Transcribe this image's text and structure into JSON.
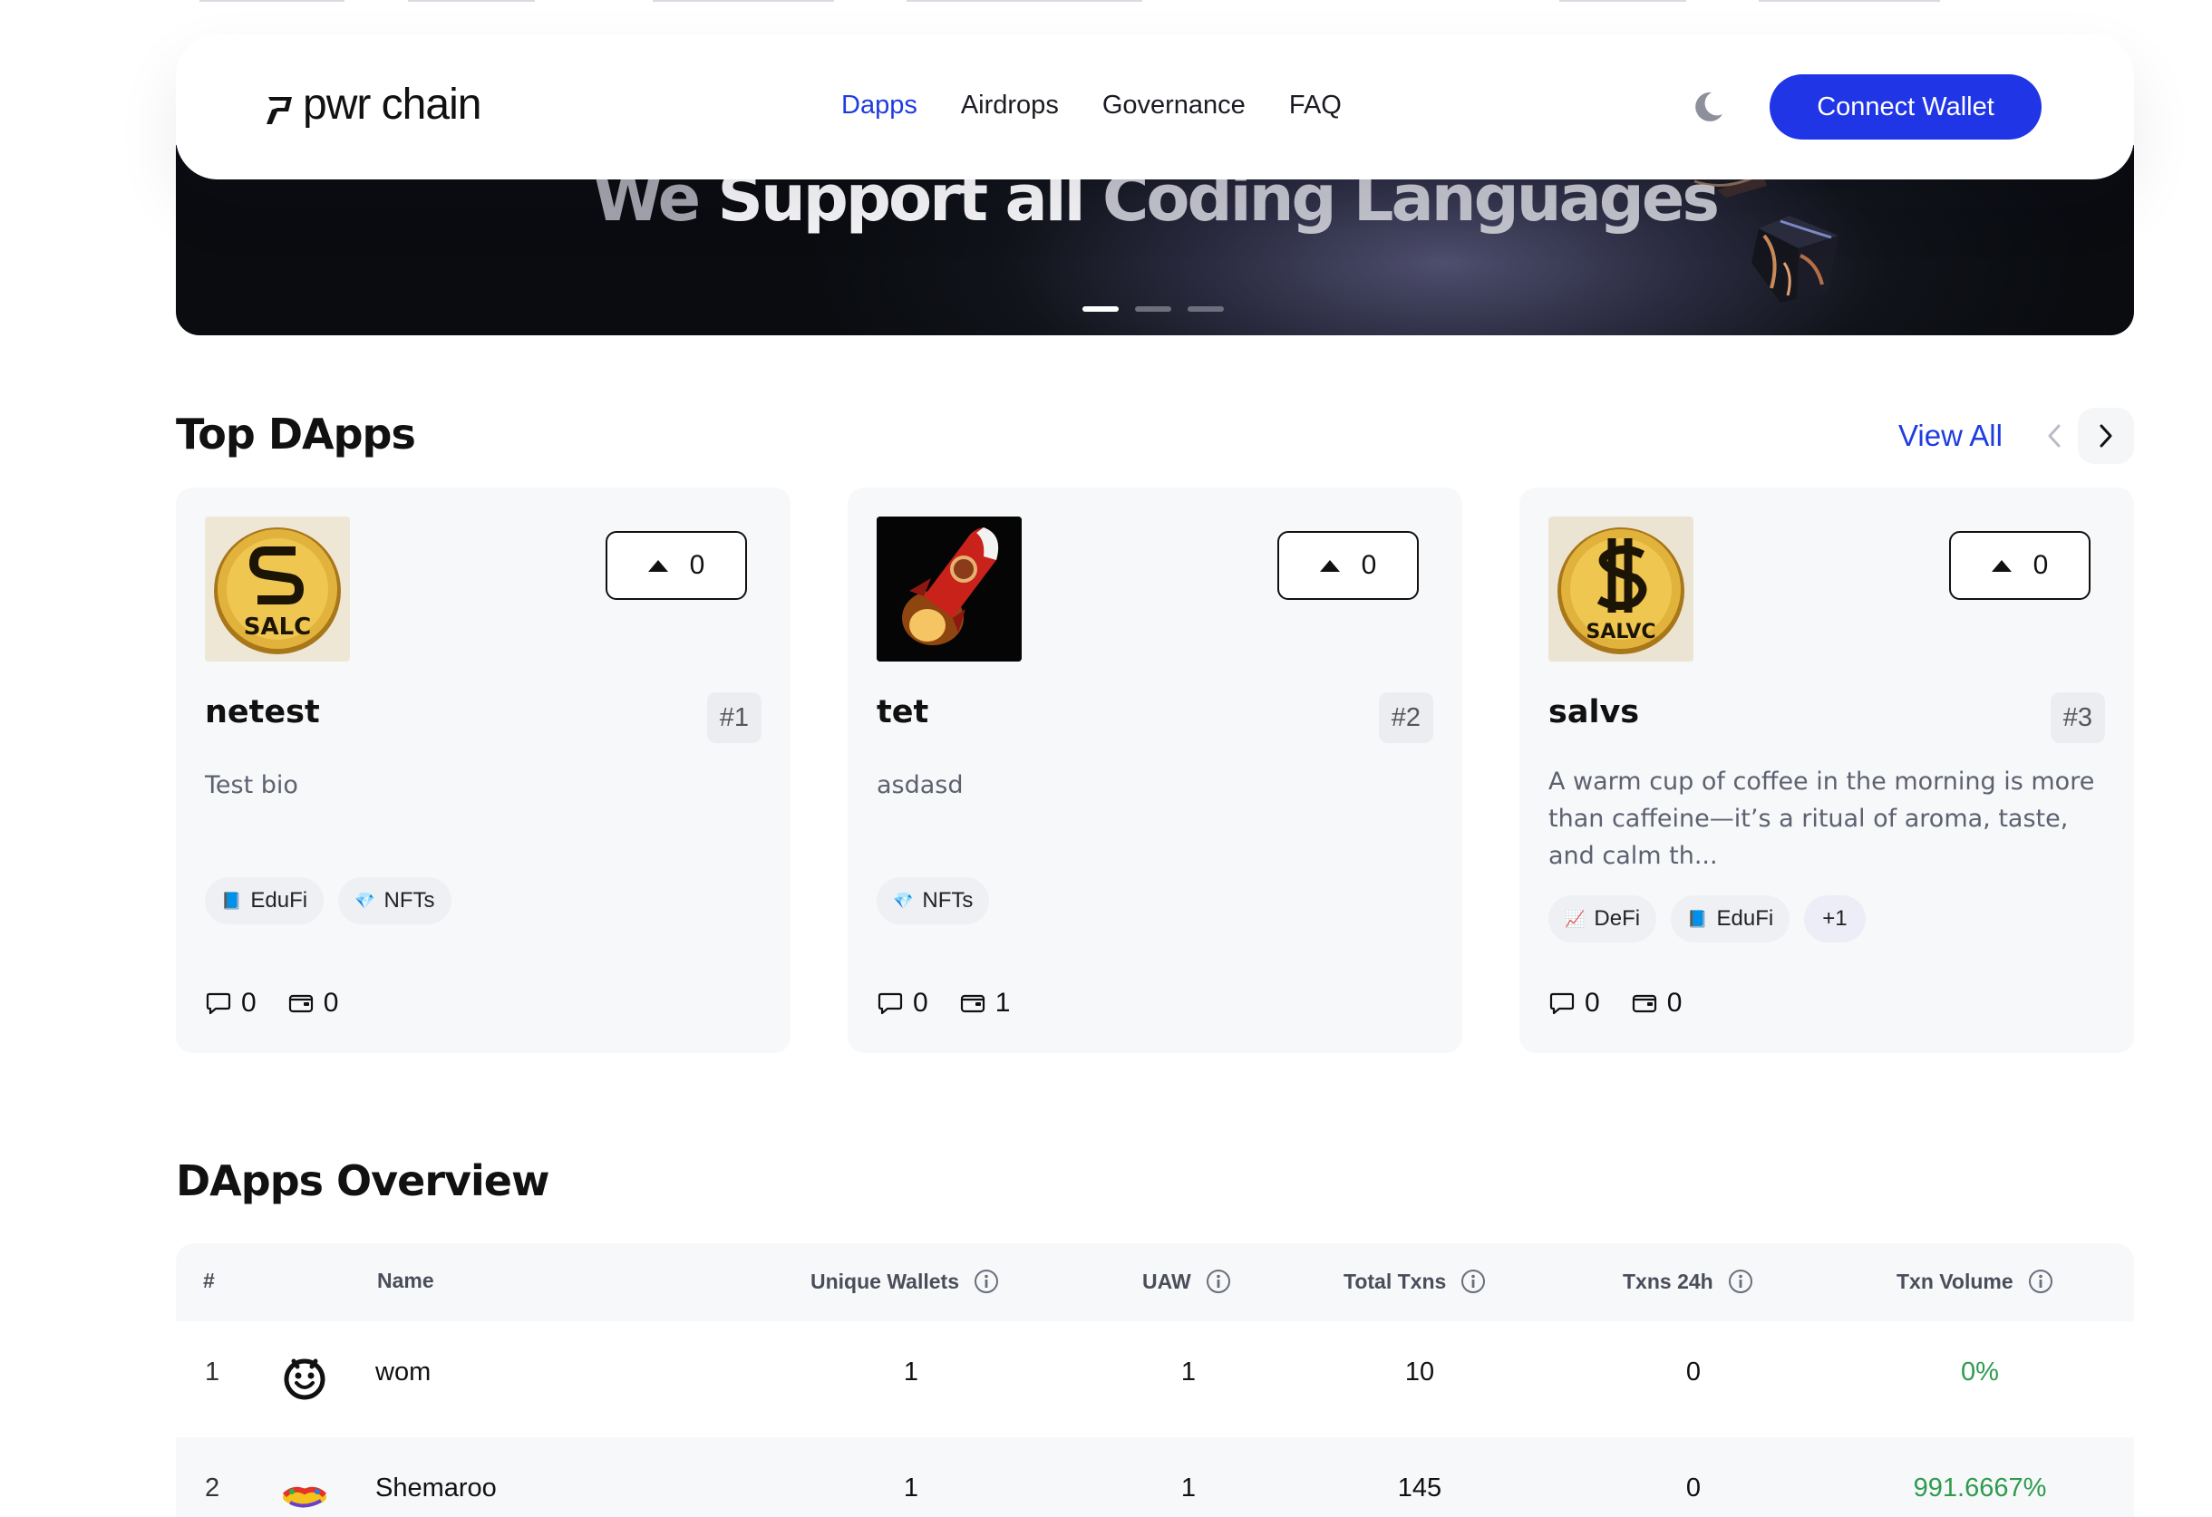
{
  "nav": {
    "logo_text": "pwr chain",
    "links": [
      "Dapps",
      "Airdrops",
      "Governance",
      "FAQ"
    ],
    "active_link": "Dapps",
    "connect_label": "Connect Wallet",
    "accent_color": "#1f35e6"
  },
  "hero": {
    "title_part1": "We",
    "title_part2": "Support all",
    "title_part3": "Coding Languages",
    "slide_count": 3,
    "active_slide": 1
  },
  "top_dapps": {
    "title": "Top DApps",
    "view_all": "View All",
    "cards": [
      {
        "name": "netest",
        "rank": "#1",
        "votes": "0",
        "bio": "Test bio",
        "tags": [
          {
            "icon": "book-icon",
            "label": "EduFi"
          },
          {
            "icon": "gem-icon",
            "label": "NFTs"
          }
        ],
        "more_tags": "",
        "comments": "0",
        "wallets": "0",
        "logo_text": "SALC"
      },
      {
        "name": "tet",
        "rank": "#2",
        "votes": "0",
        "bio": "asdasd",
        "tags": [
          {
            "icon": "gem-icon",
            "label": "NFTs"
          }
        ],
        "more_tags": "",
        "comments": "0",
        "wallets": "1",
        "logo_text": ""
      },
      {
        "name": "salvs",
        "rank": "#3",
        "votes": "0",
        "bio": "A warm cup of coffee in the morning is more than caffeine—it’s a ritual of aroma, taste, and calm th...",
        "tags": [
          {
            "icon": "chart-icon",
            "label": "DeFi"
          },
          {
            "icon": "book-icon",
            "label": "EduFi"
          }
        ],
        "more_tags": "+1",
        "comments": "0",
        "wallets": "0",
        "logo_text": "SALVC"
      }
    ]
  },
  "overview": {
    "title": "DApps Overview",
    "columns": [
      "#",
      "Name",
      "Unique Wallets",
      "UAW",
      "Total Txns",
      "Txns 24h",
      "Txn Volume"
    ],
    "rows": [
      {
        "rank": "1",
        "name": "wom",
        "unique_wallets": "1",
        "uaw": "1",
        "total_txns": "10",
        "txns_24h": "0",
        "volume": "0%"
      },
      {
        "rank": "2",
        "name": "Shemaroo",
        "unique_wallets": "1",
        "uaw": "1",
        "total_txns": "145",
        "txns_24h": "0",
        "volume": "991.6667%"
      }
    ],
    "positive_color": "#2e9b4e"
  }
}
